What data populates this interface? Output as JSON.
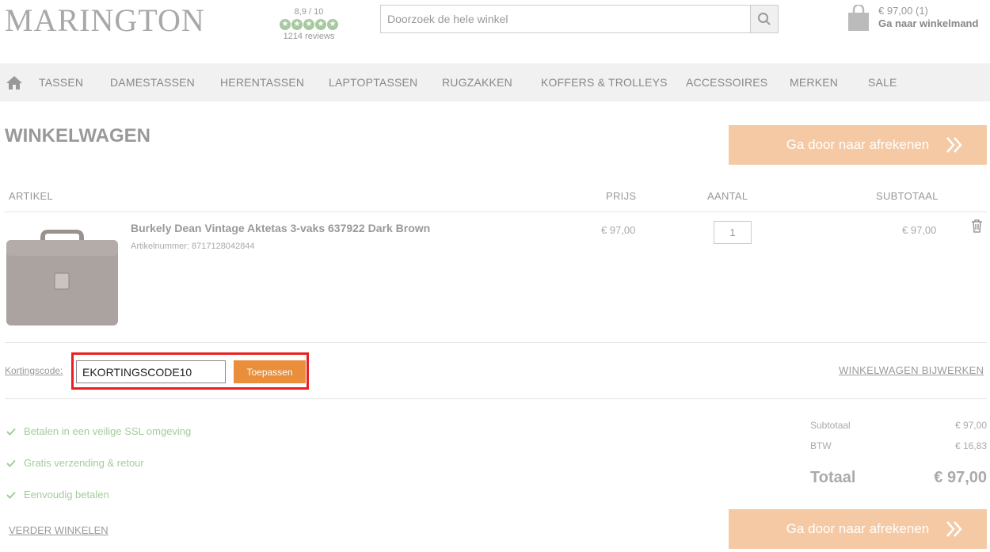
{
  "header": {
    "logo": "MARINGTON",
    "rating": {
      "score": "8,9 / 10",
      "stars": 5,
      "reviews": "1214 reviews"
    },
    "search": {
      "placeholder": "Doorzoek de hele winkel"
    },
    "cart": {
      "amount": "€ 97,00 (1)",
      "link": "Ga naar winkelmand"
    }
  },
  "nav": {
    "items": [
      "TASSEN",
      "DAMESTASSEN",
      "HERENTASSEN",
      "LAPTOPTASSEN",
      "RUGZAKKEN",
      "KOFFERS & TROLLEYS",
      "ACCESSOIRES",
      "MERKEN",
      "SALE"
    ]
  },
  "page": {
    "title": "WINKELWAGEN",
    "checkout_label": "Ga door naar afrekenen"
  },
  "table": {
    "headers": [
      "ARTIKEL",
      "PRIJS",
      "AANTAL",
      "SUBTOTAAL"
    ],
    "rows": [
      {
        "name": "Burkely Dean Vintage Aktetas 3-vaks 637922 Dark Brown",
        "sku": "Artikelnummer: 8717128042844",
        "price": "€ 97,00",
        "qty": "1",
        "subtotal": "€ 97,00"
      }
    ]
  },
  "coupon": {
    "label": "Kortingscode:",
    "value": "EKORTINGSCODE10",
    "apply": "Toepassen",
    "update": "WINKELWAGEN BIJWERKEN"
  },
  "usps": [
    "Betalen in een veilige SSL omgeving",
    "Gratis verzending & retour",
    "Eenvoudig betalen"
  ],
  "totals": {
    "subtotal_label": "Subtotaal",
    "subtotal": "€ 97,00",
    "tax_label": "BTW",
    "tax": "€ 16,83",
    "total_label": "Totaal",
    "total": "€ 97,00"
  },
  "continue_label": "VERDER WINKELEN",
  "colors": {
    "accent": "#e98e3a",
    "checkout": "#f5c9a3",
    "usp": "#a3cc9c",
    "highlight": "#ea1f1f"
  }
}
